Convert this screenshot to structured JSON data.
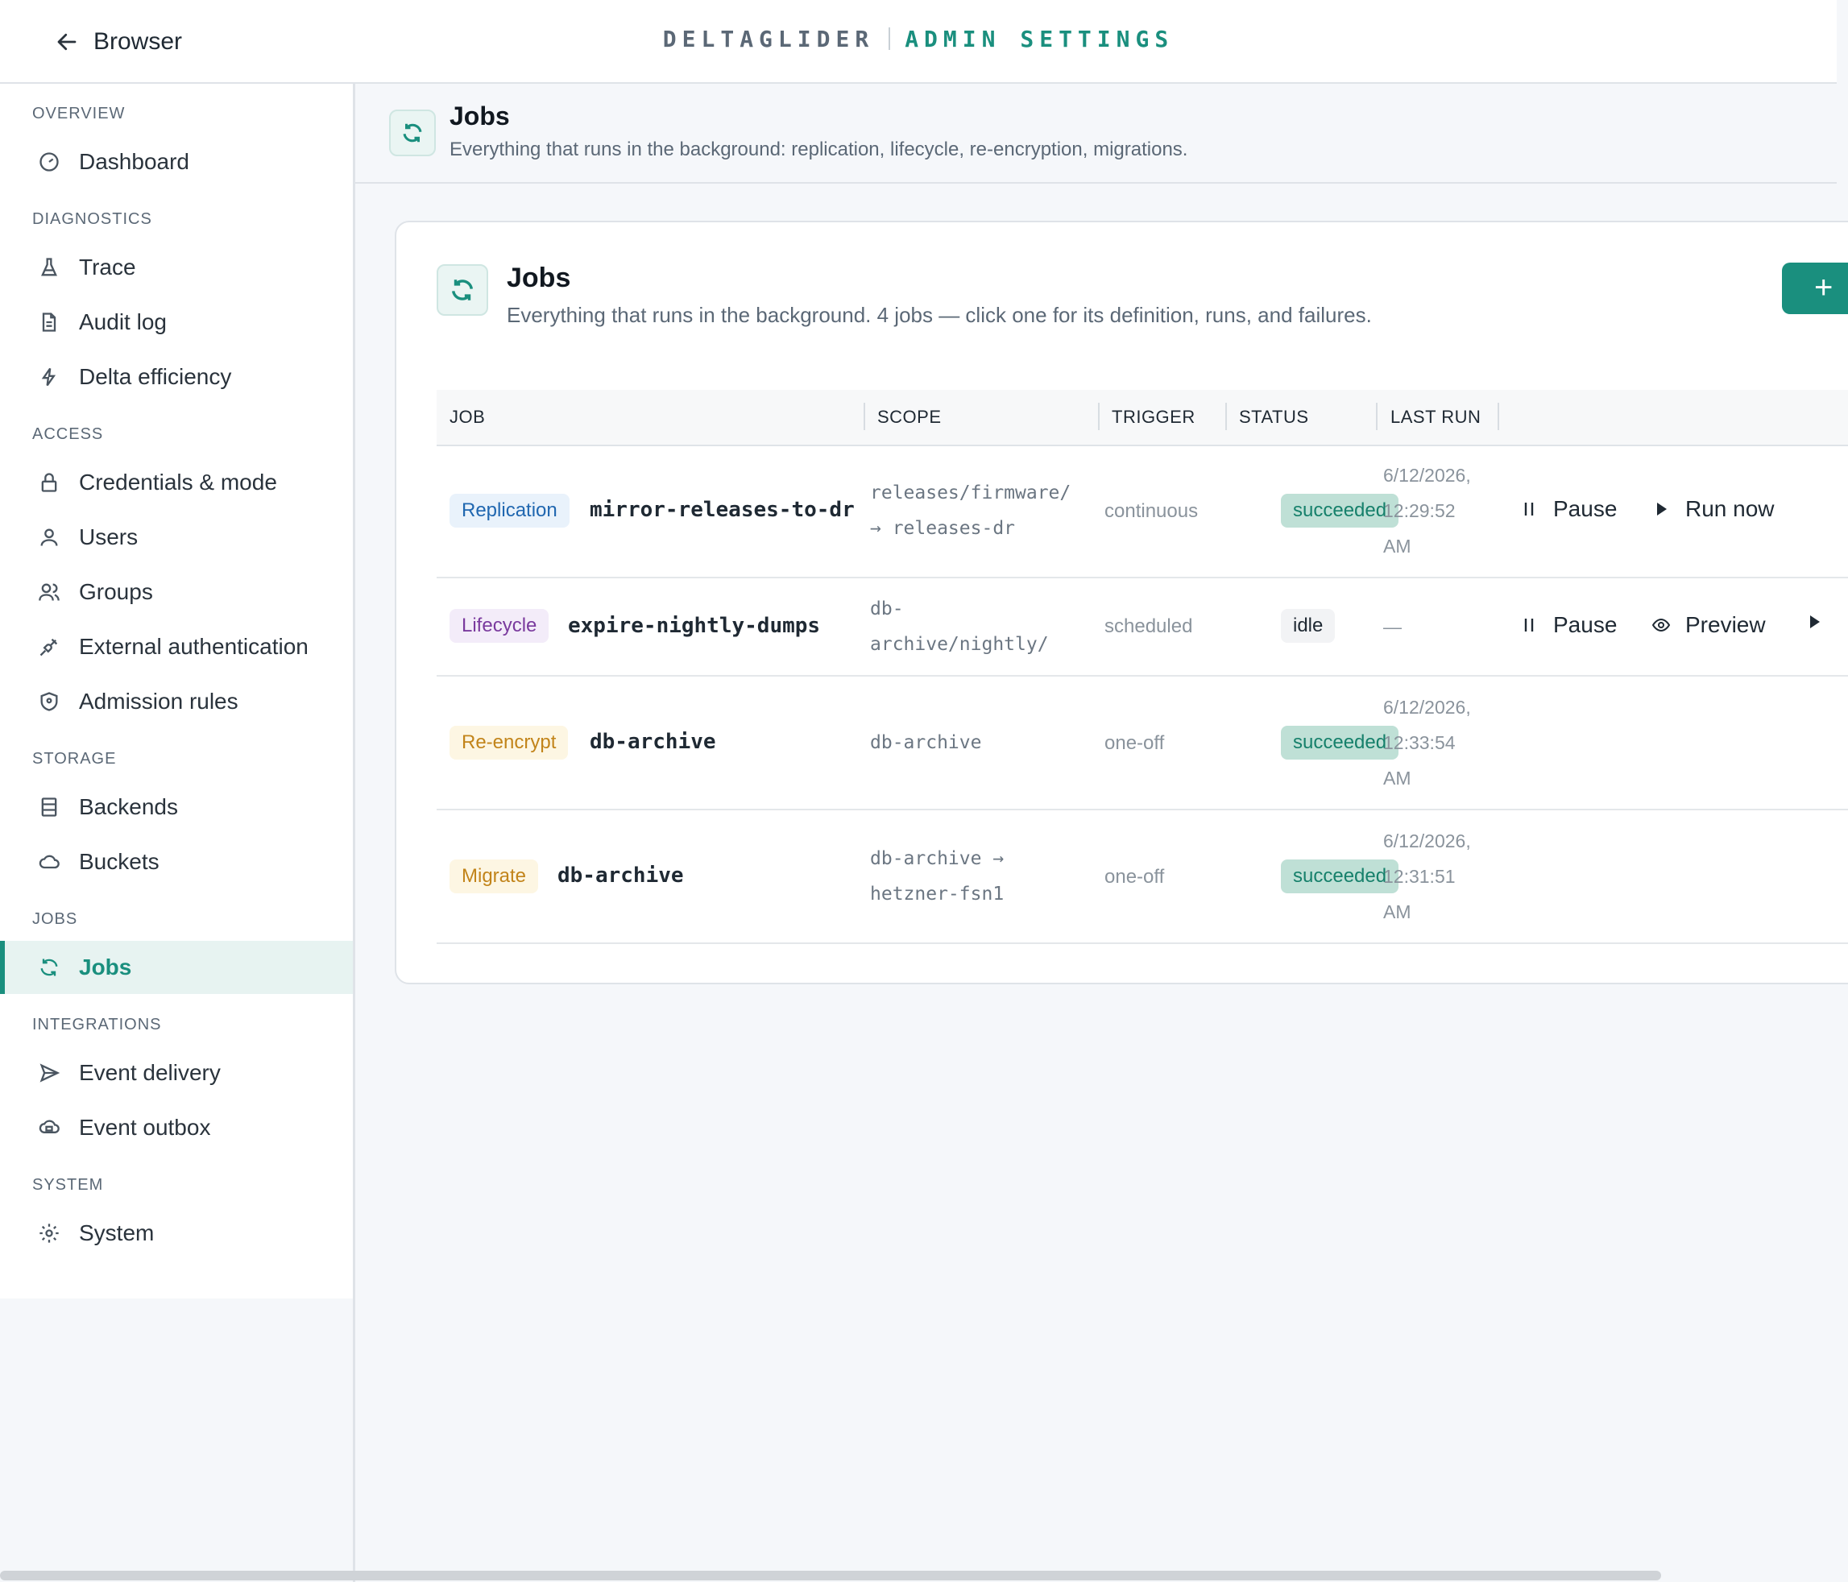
{
  "topbar": {
    "back_label": "Browser",
    "brand_primary": "DELTAGLIDER",
    "brand_secondary": "ADMIN SETTINGS"
  },
  "sidebar": {
    "sections": [
      {
        "label": "OVERVIEW",
        "items": [
          {
            "label": "Dashboard",
            "icon": "gauge-icon"
          }
        ]
      },
      {
        "label": "DIAGNOSTICS",
        "items": [
          {
            "label": "Trace",
            "icon": "flask-icon"
          },
          {
            "label": "Audit log",
            "icon": "document-icon"
          },
          {
            "label": "Delta efficiency",
            "icon": "bolt-icon"
          }
        ]
      },
      {
        "label": "ACCESS",
        "items": [
          {
            "label": "Credentials & mode",
            "icon": "lock-icon"
          },
          {
            "label": "Users",
            "icon": "user-icon"
          },
          {
            "label": "Groups",
            "icon": "users-icon"
          },
          {
            "label": "External authentication",
            "icon": "plug-icon"
          },
          {
            "label": "Admission rules",
            "icon": "shield-icon"
          }
        ]
      },
      {
        "label": "STORAGE",
        "items": [
          {
            "label": "Backends",
            "icon": "server-icon"
          },
          {
            "label": "Buckets",
            "icon": "cloud-icon"
          }
        ]
      },
      {
        "label": "JOBS",
        "items": [
          {
            "label": "Jobs",
            "icon": "refresh-icon",
            "active": true
          }
        ]
      },
      {
        "label": "INTEGRATIONS",
        "items": [
          {
            "label": "Event delivery",
            "icon": "send-icon"
          },
          {
            "label": "Event outbox",
            "icon": "outbox-icon"
          }
        ]
      },
      {
        "label": "SYSTEM",
        "items": [
          {
            "label": "System",
            "icon": "gear-icon"
          }
        ]
      }
    ]
  },
  "page_header": {
    "title": "Jobs",
    "subtitle": "Everything that runs in the background: replication, lifecycle, re-encryption, migrations."
  },
  "card": {
    "title": "Jobs",
    "subtitle": "Everything that runs in the background. 4 jobs — click one for its definition, runs, and failures.",
    "add_label": "+",
    "columns": [
      "JOB",
      "SCOPE",
      "TRIGGER",
      "STATUS",
      "LAST RUN"
    ],
    "rows": [
      {
        "type": "Replication",
        "name": "mirror-releases-to-dr",
        "scope_lines": [
          "releases/firmware/",
          "→ releases-dr"
        ],
        "trigger": "continuous",
        "status": "succeeded",
        "last_run_lines": [
          "6/12/2026,",
          "12:29:52",
          "AM"
        ],
        "actions": [
          "Pause",
          "Run now"
        ]
      },
      {
        "type": "Lifecycle",
        "name": "expire-nightly-dumps",
        "scope_lines": [
          "db-",
          "archive/nightly/"
        ],
        "trigger": "scheduled",
        "status": "idle",
        "last_run_lines": [
          "—"
        ],
        "actions": [
          "Pause",
          "Preview"
        ]
      },
      {
        "type": "Re-encrypt",
        "name": "db-archive",
        "scope_lines": [
          "db-archive"
        ],
        "trigger": "one-off",
        "status": "succeeded",
        "last_run_lines": [
          "6/12/2026,",
          "12:33:54",
          "AM"
        ],
        "actions": []
      },
      {
        "type": "Migrate",
        "name": "db-archive",
        "scope_lines": [
          "db-archive →",
          "hetzner-fsn1"
        ],
        "trigger": "one-off",
        "status": "succeeded",
        "last_run_lines": [
          "6/12/2026,",
          "12:31:51",
          "AM"
        ],
        "actions": []
      }
    ]
  },
  "colors": {
    "accent": "#1a8f7e",
    "success_bg": "#bfe0d6",
    "success_text": "#16806b"
  }
}
